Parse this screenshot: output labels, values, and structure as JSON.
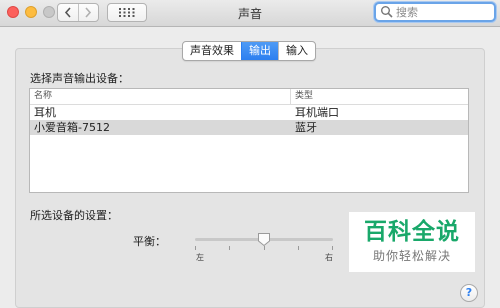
{
  "window": {
    "title": "声音",
    "search_placeholder": "搜索"
  },
  "tabs": [
    {
      "label": "声音效果",
      "active": false
    },
    {
      "label": "输出",
      "active": true
    },
    {
      "label": "输入",
      "active": false
    }
  ],
  "output": {
    "section_label": "选择声音输出设备：",
    "columns": {
      "name": "名称",
      "type": "类型"
    },
    "devices": [
      {
        "name": "耳机",
        "type": "耳机端口",
        "selected": false
      },
      {
        "name": "小爱音箱-7512",
        "type": "蓝牙",
        "selected": true
      }
    ]
  },
  "device_settings": {
    "section_label": "所选设备的设置：",
    "balance_label": "平衡：",
    "balance_left": "左",
    "balance_right": "右",
    "balance_value_fraction": 0.5
  },
  "watermark": {
    "title": "百科全说",
    "subtitle": "助你轻松解决"
  },
  "help_label": "?",
  "colors": {
    "accent": "#2c7ff0",
    "watermark_green": "#19a86a"
  }
}
